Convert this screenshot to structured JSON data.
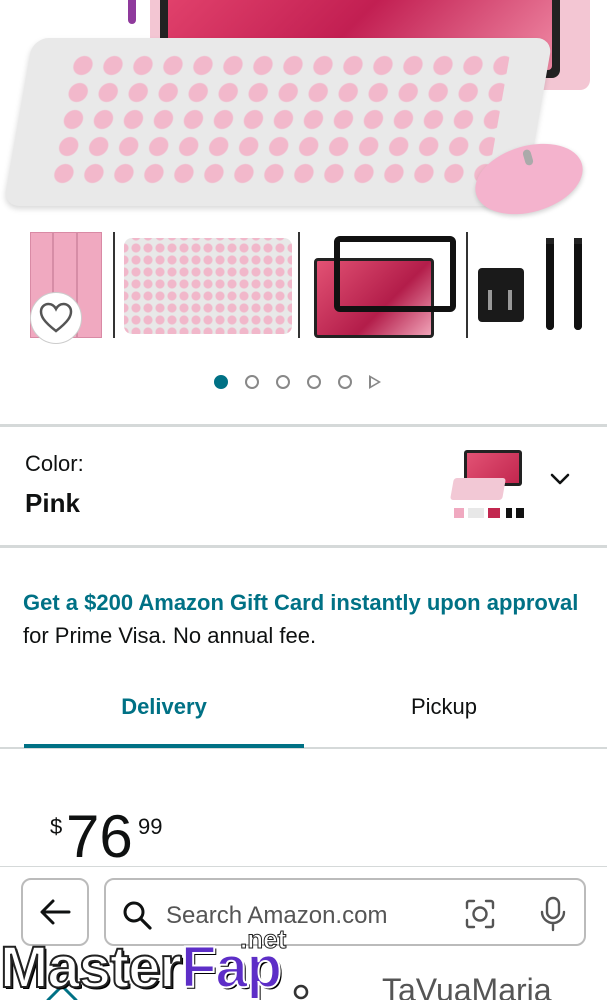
{
  "gallery": {
    "active_index": 0,
    "dot_count": 5,
    "thumbnails": [
      "pink-case",
      "keyboard",
      "screen-protector",
      "charger-cable"
    ]
  },
  "color": {
    "label": "Color:",
    "value": "Pink"
  },
  "promo": {
    "link_text": "Get a $200 Amazon Gift Card instantly upon approval",
    "rest_text": " for Prime Visa. No annual fee."
  },
  "tabs": [
    {
      "label": "Delivery",
      "selected": true
    },
    {
      "label": "Pickup",
      "selected": false
    }
  ],
  "price": {
    "symbol": "$",
    "whole": "76",
    "fraction": "99"
  },
  "search": {
    "placeholder": "Search Amazon.com"
  },
  "bottom_nav": {
    "partial_text": "TaVuaMaria"
  },
  "watermark": {
    "brand_main": "Master",
    "brand_accent": "Fap",
    "brand_tld": ".net"
  },
  "colors": {
    "accent_teal": "#007185",
    "text": "#0f1111",
    "divider": "#d5d9d9",
    "product_pink": "#f4b3cd"
  }
}
